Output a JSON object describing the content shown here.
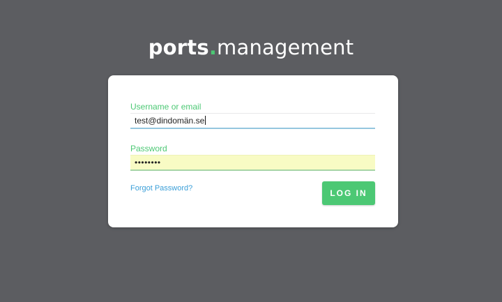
{
  "logo": {
    "brand": "ports",
    "dot": ".",
    "rest": "management"
  },
  "login": {
    "username_label": "Username or email",
    "username_value": "test@dindomän.se",
    "password_label": "Password",
    "password_value": "••••••••",
    "forgot_label": "Forgot Password?",
    "login_label": "LOG IN"
  },
  "colors": {
    "background": "#5c5d61",
    "accent": "#4cc874",
    "link": "#3b9fd8",
    "autofill": "#f8fbc4"
  }
}
